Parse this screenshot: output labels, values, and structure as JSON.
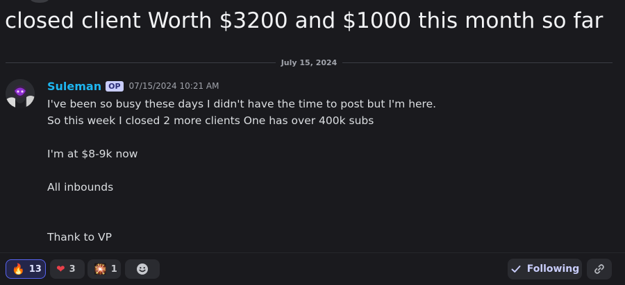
{
  "thread": {
    "title": "closed client Worth $3200 and $1000 this month so far",
    "date_divider": "July 15, 2024"
  },
  "message": {
    "author": "Suleman",
    "badge": "OP",
    "timestamp": "07/15/2024 10:21 AM",
    "lines": [
      "I've been so busy these days I didn't have the time to post but I'm here.",
      "So this week I closed 2 more clients One has over 400k subs",
      "I'm at $8-9k now",
      "All inbounds",
      "Thank to VP"
    ]
  },
  "reactions": [
    {
      "emoji": "🔥",
      "count": "13",
      "active": true,
      "icon": "fire-icon"
    },
    {
      "emoji": "❤",
      "count": "3",
      "active": false,
      "icon": "heart-icon"
    },
    {
      "emoji": "🎇",
      "count": "1",
      "active": false,
      "icon": "sparkler-icon"
    }
  ],
  "actions": {
    "following_label": "Following",
    "add_reaction_icon": "smile-icon",
    "copy_link_icon": "link-icon"
  },
  "colors": {
    "author": "#1eb6f0",
    "accent": "#5865f2",
    "heart": "#e8404a"
  }
}
